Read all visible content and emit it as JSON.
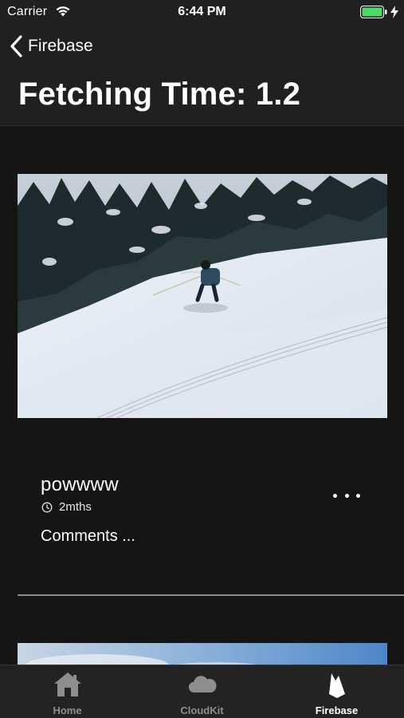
{
  "status_bar": {
    "carrier": "Carrier",
    "time": "6:44 PM",
    "battery_color": "#4cd964"
  },
  "nav": {
    "back_label": "Firebase",
    "title": "Fetching Time: 1.2"
  },
  "post": {
    "title": "powwww",
    "time": "2mths",
    "comments": "Comments ..."
  },
  "tab_bar": {
    "tabs": [
      {
        "label": "Home",
        "icon": "home-icon",
        "active": false
      },
      {
        "label": "CloudKit",
        "icon": "cloud-icon",
        "active": false
      },
      {
        "label": "Firebase",
        "icon": "firebase-flame-icon",
        "active": true
      }
    ],
    "active_color": "#ffffff",
    "inactive_color": "#8e8e8e"
  }
}
